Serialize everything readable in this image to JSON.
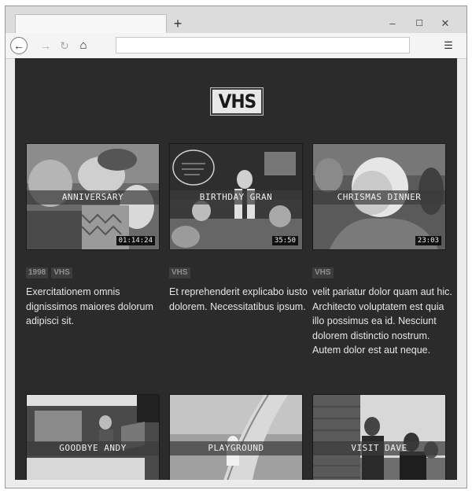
{
  "browser": {
    "new_tab_glyph": "+",
    "minimize_glyph": "–",
    "maximize_glyph": "☐",
    "close_glyph": "✕",
    "back_glyph": "←",
    "forward_glyph": "→",
    "reload_glyph": "↻",
    "home_glyph": "⌂",
    "menu_glyph": "☰",
    "url": ""
  },
  "logo": {
    "text": "VHS"
  },
  "cards": [
    {
      "title": "ANNIVERSARY",
      "duration": "01:14:24",
      "tags": [
        "1998",
        "VHS"
      ],
      "description": "Exercitationem omnis dignissimos maiores dolorum adipisci sit."
    },
    {
      "title": "BIRTHDAY GRAN",
      "duration": "35:50",
      "tags": [
        "VHS"
      ],
      "description": "Et reprehenderit explicabo iusto dolorem. Necessitatibus ipsum."
    },
    {
      "title": "CHRISMAS DINNER",
      "duration": "23:03",
      "tags": [
        "VHS"
      ],
      "description": "velit pariatur dolor quam aut hic. Architecto voluptatem est quia illo possimus ea id. Nesciunt dolorem distinctio nostrum. Autem dolor est aut neque."
    },
    {
      "title": "GOODBYE ANDY"
    },
    {
      "title": "PLAYGROUND"
    },
    {
      "title": "VISIT DAVE"
    }
  ]
}
